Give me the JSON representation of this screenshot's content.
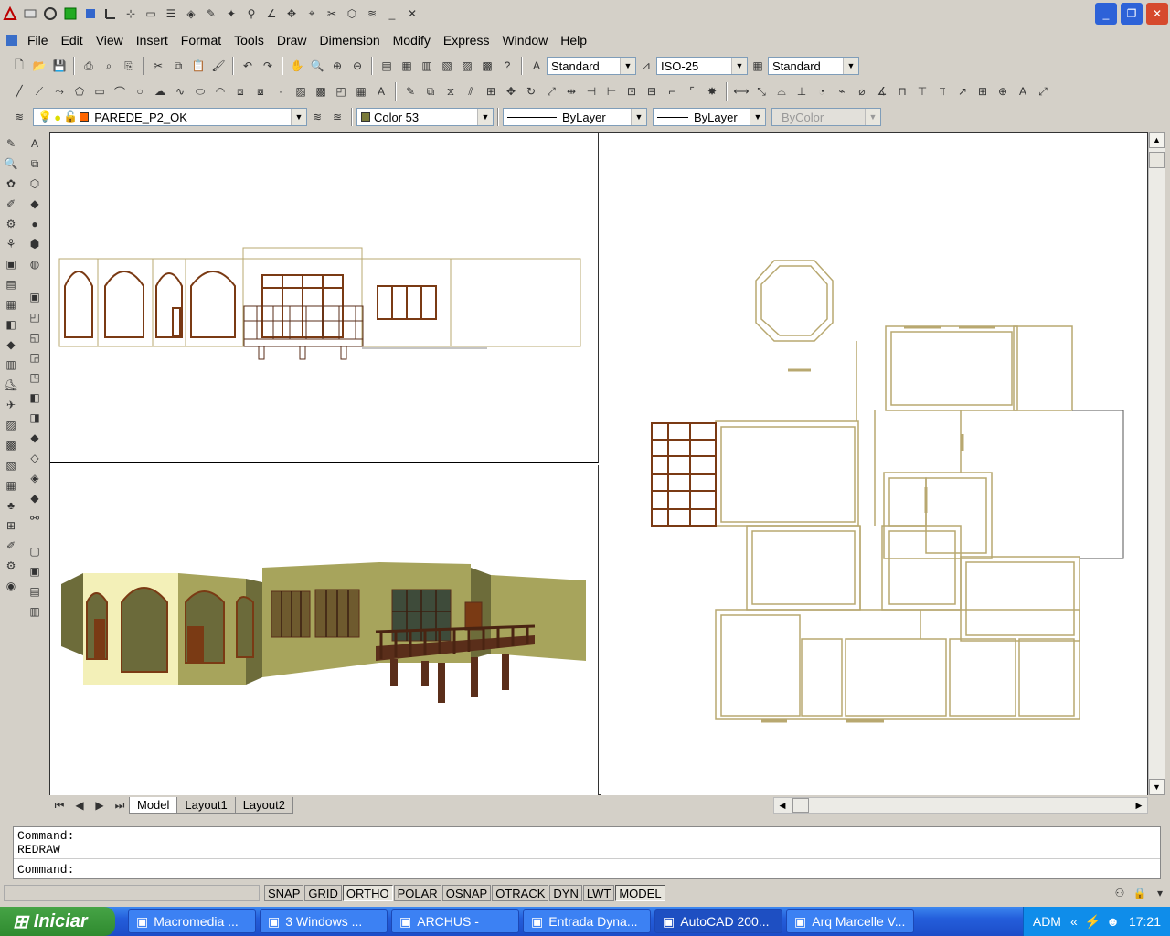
{
  "menu": [
    "File",
    "Edit",
    "View",
    "Insert",
    "Format",
    "Tools",
    "Draw",
    "Dimension",
    "Modify",
    "Express",
    "Window",
    "Help"
  ],
  "styles": {
    "text_style": "Standard",
    "dim_style": "ISO-25",
    "table_style": "Standard"
  },
  "layers": {
    "current_layer": "PAREDE_P2_OK",
    "color": "Color 53",
    "linetype": "ByLayer",
    "lineweight": "ByLayer",
    "plotstyle": "ByColor"
  },
  "tabs": [
    "Model",
    "Layout1",
    "Layout2"
  ],
  "command": {
    "line1": "Command:",
    "line2": "REDRAW",
    "prompt": "Command:"
  },
  "status_toggles": [
    {
      "label": "SNAP",
      "on": false
    },
    {
      "label": "GRID",
      "on": false
    },
    {
      "label": "ORTHO",
      "on": true
    },
    {
      "label": "POLAR",
      "on": false
    },
    {
      "label": "OSNAP",
      "on": false
    },
    {
      "label": "OTRACK",
      "on": false
    },
    {
      "label": "DYN",
      "on": false
    },
    {
      "label": "LWT",
      "on": false
    },
    {
      "label": "MODEL",
      "on": true
    }
  ],
  "taskbar": {
    "start": "Iniciar",
    "tasks": [
      "Macromedia ...",
      "3 Windows ...",
      "ARCHUS -",
      "Entrada Dyna...",
      "AutoCAD 200...",
      "Arq Marcelle V..."
    ],
    "active_task": "AutoCAD 200...",
    "tray_label": "ADM",
    "clock": "17:21"
  },
  "colors": {
    "wall_line": "#b8a870",
    "frame": "#7a3a14",
    "facade_light": "#f3f0b8",
    "facade_mid": "#a7a45c",
    "facade_dark": "#6d6c3a",
    "deck": "#5a2e1a"
  }
}
